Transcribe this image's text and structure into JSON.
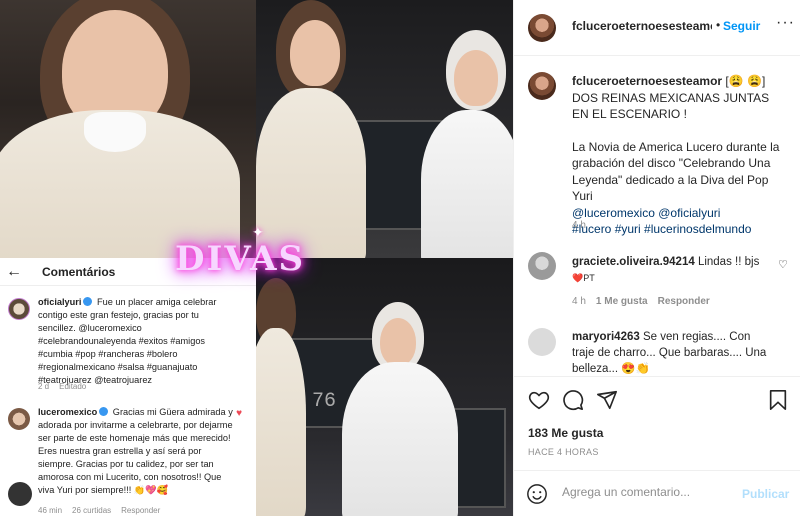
{
  "media": {
    "overlay_text": "DIVAS",
    "case_label": "76",
    "comments_panel": {
      "title": "Comentários",
      "back": "←",
      "items": [
        {
          "user": "oficialyuri",
          "text": "Fue un placer amiga celebrar contigo este gran festejo, gracias por tu sencillez. @luceromexico #celebrandounaleyenda #exitos #amigos #cumbia #pop #rancheras #bolero #regionalmexicano #salsa #guanajuato #teatrojuarez @teatrojuarez",
          "meta": [
            "2 d",
            "Editado"
          ]
        },
        {
          "user": "luceromexico",
          "text": "Gracias mi Güera admirada y adorada por invitarme a celebrarte, por dejarme ser parte de este homenaje más que merecido! Eres nuestra gran estrella y así será por siempre. Gracias por tu calidez, por ser tan amorosa con mi Lucerito, con nosotros!! Que viva Yuri por siempre!!! 👏💖🥰",
          "meta": [
            "46 min",
            "26 curtidas",
            "Responder"
          ]
        }
      ]
    }
  },
  "header": {
    "username": "fcluceroeternoesesteamor",
    "separator": "•",
    "follow": "Seguir",
    "more": "···"
  },
  "caption": {
    "username": "fcluceroeternoesesteamor",
    "line1": " [😩 😩] DOS REINAS MEXICANAS JUNTAS EN EL ESCENARIO !",
    "para2": "La Novia de America Lucero durante la grabación del disco \"Celebrando Una Leyenda\" dedicado a la Diva del Pop Yuri",
    "mentions": "@luceromexico @oficialyuri",
    "hashtags": "#lucero #yuri #lucerinosdelmundo",
    "time": "4 h"
  },
  "comments": [
    {
      "username": "graciete.oliveira.94214",
      "text": " Lindas !! bjs",
      "text2": "❤️PT",
      "meta": [
        "4 h",
        "1 Me gusta",
        "Responder"
      ]
    },
    {
      "username": "maryori4263",
      "text": " Se ven regias.... Con traje de charro... Que barbaras.... Una belleza... 😍👏"
    }
  ],
  "actions": {
    "likes": "183 Me gusta",
    "time": "HACE 4 HORAS"
  },
  "add_comment": {
    "placeholder": "Agrega un comentario...",
    "post": "Publicar"
  }
}
